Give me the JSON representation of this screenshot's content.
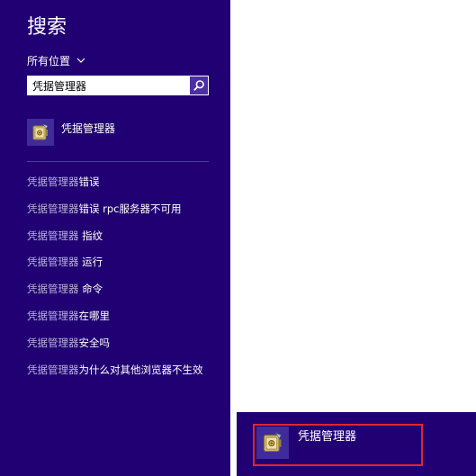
{
  "search_pane": {
    "title": "搜索",
    "scope": {
      "label": "所有位置",
      "icon": "chevron-down-icon"
    },
    "search": {
      "value": "凭据管理器",
      "button_icon": "search-icon"
    },
    "top_result": {
      "label": "凭据管理器",
      "icon": "credential-manager-icon"
    },
    "suggestions": [
      {
        "main": "凭据管理器",
        "rest": "错误"
      },
      {
        "main": "凭据管理器",
        "rest": "错误 rpc服务器不可用"
      },
      {
        "main": "凭据管理器",
        "rest": " 指纹"
      },
      {
        "main": "凭据管理器",
        "rest": " 运行"
      },
      {
        "main": "凭据管理器",
        "rest": " 命令"
      },
      {
        "main": "凭据管理器",
        "rest": "在哪里"
      },
      {
        "main": "凭据管理器",
        "rest": "安全吗"
      },
      {
        "main": "凭据管理器",
        "rest": "为什么对其他浏览器不生效"
      }
    ]
  },
  "callout": {
    "result": {
      "label": "凭据管理器",
      "icon": "credential-manager-icon"
    },
    "highlight_color": "#e0262b"
  },
  "colors": {
    "pane_background": "#200072",
    "page_background": "#ffffff",
    "tile_background": "#3f2b99",
    "suggestion_muted": "#b9b3dc"
  }
}
